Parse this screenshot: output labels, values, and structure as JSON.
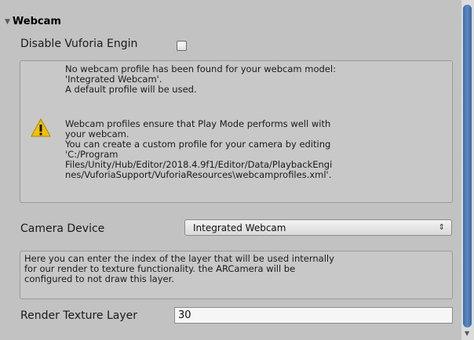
{
  "section": {
    "title": "Webcam"
  },
  "disable_vuforia": {
    "label": "Disable Vuforia Engin",
    "checked": false
  },
  "webcam_help": {
    "line1": "No webcam profile has been found for your webcam model:\n'Integrated Webcam'.\nA default profile will be used.",
    "line2": "Webcam profiles ensure that Play Mode performs well with\nyour webcam.\nYou can create a custom profile for your camera by editing\n'C:/Program\nFiles/Unity/Hub/Editor/2018.4.9f1/Editor/Data/PlaybackEngi\nnes/VuforiaSupport/VuforiaResources\\webcamprofiles.xml'.",
    "icon": "warning-icon"
  },
  "camera_device": {
    "label": "Camera Device",
    "value": "Integrated Webcam"
  },
  "texture_help": {
    "text": "Here you can enter the index of the layer that will be used internally\nfor our render to texture functionality. the ARCamera will be\nconfigured to not draw this layer."
  },
  "render_texture": {
    "label": "Render Texture Layer",
    "value": "30"
  },
  "colors": {
    "panel": "#c2c2c2",
    "scrollbar_thumb": "#4a7ab8",
    "warning": "#f2c200"
  }
}
